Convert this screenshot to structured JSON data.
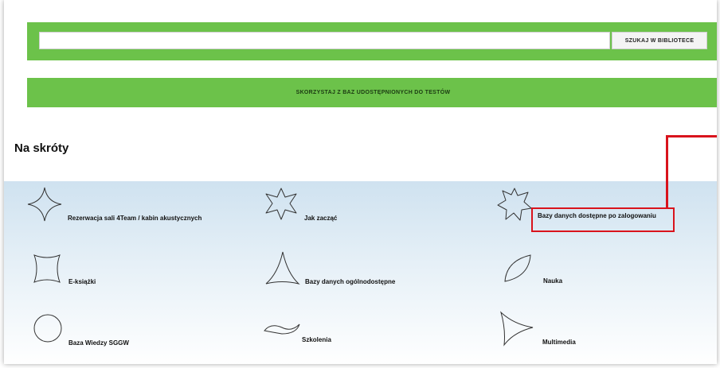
{
  "search": {
    "button_label": "SZUKAJ W BIBLIOTECE",
    "placeholder": ""
  },
  "test_banner": {
    "label": "SKORZYSTAJ Z BAZ UDOSTĘPNIONYCH DO TESTÓW"
  },
  "shortcuts": {
    "title": "Na skróty",
    "items": [
      {
        "label": "Rezerwacja sali 4Team / kabin akustycznych",
        "icon": "diamond-icon"
      },
      {
        "label": "Jak zacząć",
        "icon": "star-icon"
      },
      {
        "label": "Bazy danych dostępne po zalogowaniu",
        "icon": "star-icon"
      },
      {
        "label": "E-książki",
        "icon": "square-icon"
      },
      {
        "label": "Bazy danych ogólnodostępne",
        "icon": "triangle-icon"
      },
      {
        "label": "Nauka",
        "icon": "leaf-icon"
      },
      {
        "label": "Baza Wiedzy SGGW",
        "icon": "circle-icon"
      },
      {
        "label": "Szkolenia",
        "icon": "wave-icon"
      },
      {
        "label": "Multimedia",
        "icon": "play-triangle-icon"
      }
    ]
  },
  "colors": {
    "accent_green": "#6cc24a",
    "highlight_red": "#d9131c"
  }
}
